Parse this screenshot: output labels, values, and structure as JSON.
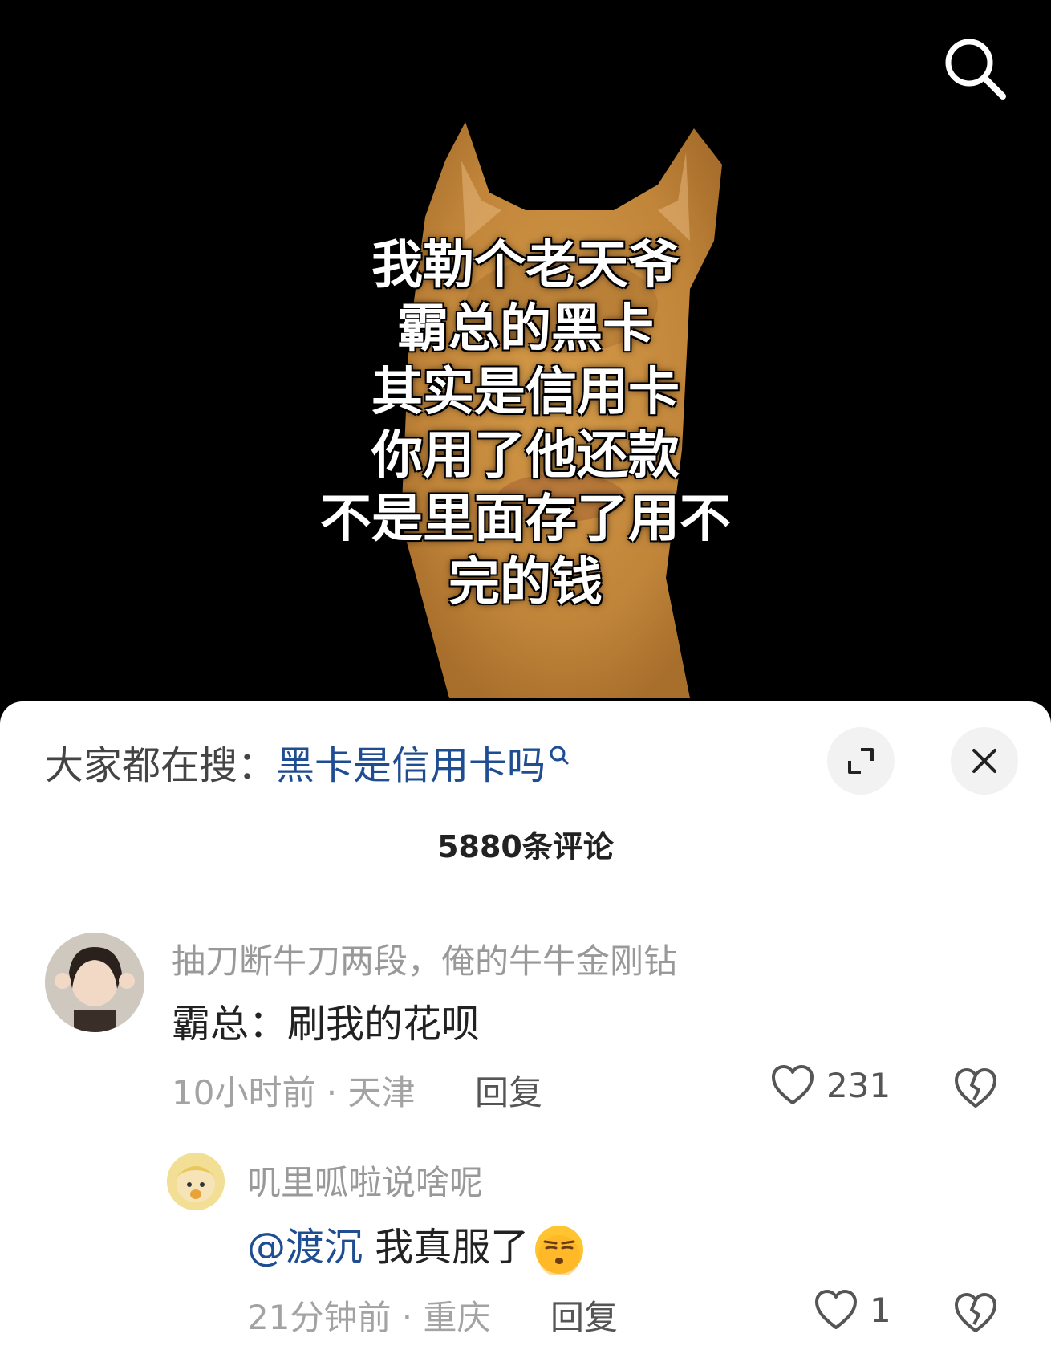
{
  "video": {
    "caption_lines": [
      "我勒个老天爷",
      "霸总的黑卡",
      "其实是信用卡",
      "你用了他还款",
      "不是里面存了用不",
      "完的钱"
    ]
  },
  "sheet": {
    "search_prefix": "大家都在搜：",
    "search_term": "黑卡是信用卡吗",
    "comment_count": "5880条评论"
  },
  "comments": [
    {
      "user": "抽刀断牛刀两段，俺的牛牛金刚钻",
      "text": "霸总：刷我的花呗",
      "meta": "10小时前 · 天津",
      "reply_label": "回复",
      "likes": "231"
    },
    {
      "user": "叽里呱啦说啥呢",
      "mention": "@渡沉",
      "text": " 我真服了",
      "meta": "21分钟前 · 重庆",
      "reply_label": "回复",
      "likes": "1"
    }
  ],
  "icons": [
    "search-icon",
    "expand-icon",
    "close-icon",
    "heart-icon",
    "broken-heart-icon",
    "smirk-emoji-icon"
  ],
  "colors": {
    "link": "#1f4d92",
    "background_video": "#000000",
    "sheet": "#ffffff",
    "dog": "#c98e3c"
  }
}
